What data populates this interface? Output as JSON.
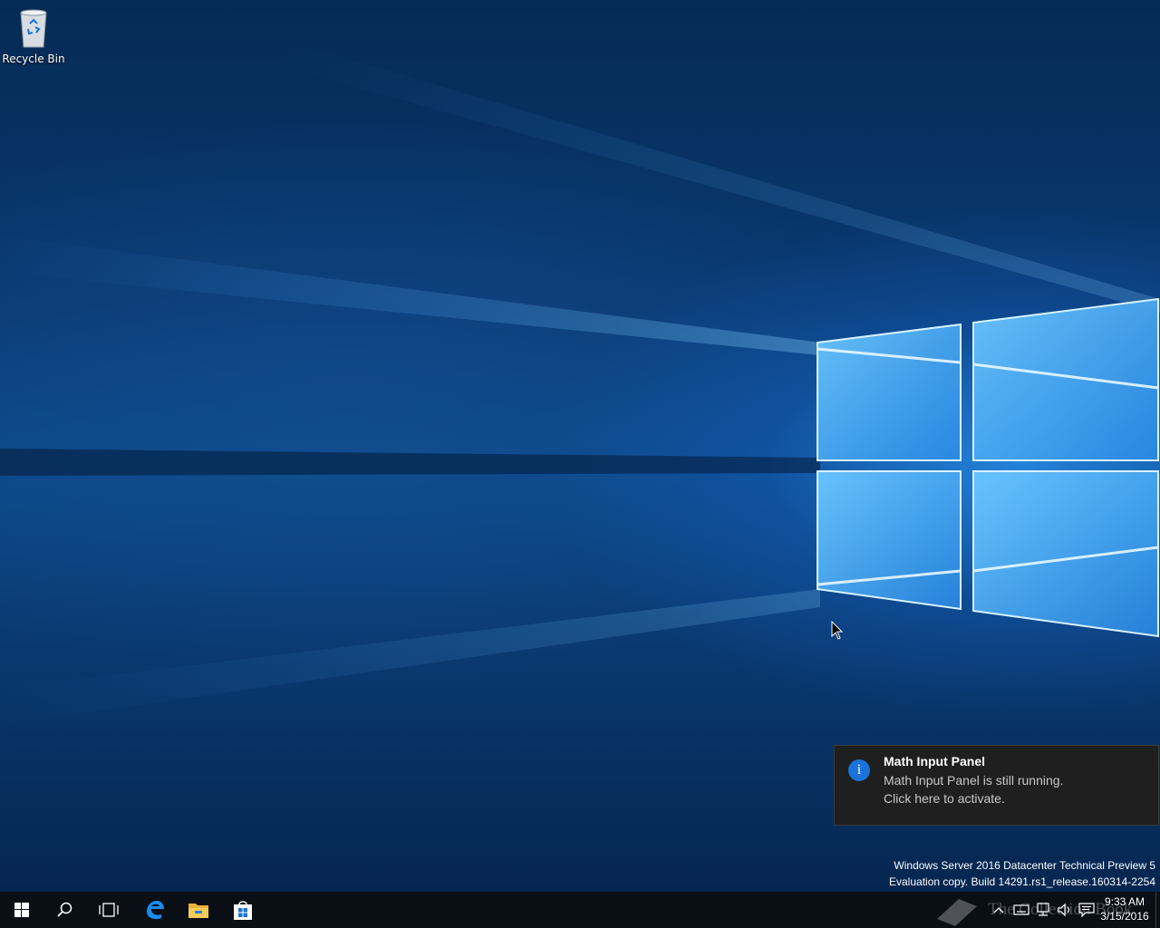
{
  "desktop": {
    "icons": [
      {
        "label": "Recycle Bin",
        "icon": "recycle-bin-icon"
      }
    ],
    "watermark": {
      "line1": "Windows Server 2016 Datacenter Technical Preview 5",
      "line2": "Evaluation copy. Build 14291.rs1_release.160314-2254"
    }
  },
  "toast": {
    "icon": "info-icon",
    "icon_glyph": "i",
    "title": "Math Input Panel",
    "line1": "Math Input Panel is still running.",
    "line2": "Click here to activate."
  },
  "taskbar": {
    "buttons": [
      {
        "name": "start",
        "icon": "windows-logo-icon"
      },
      {
        "name": "search",
        "icon": "search-icon"
      },
      {
        "name": "task-view",
        "icon": "task-view-icon"
      },
      {
        "name": "edge",
        "icon": "edge-browser-icon"
      },
      {
        "name": "file-explorer",
        "icon": "folder-icon"
      },
      {
        "name": "store",
        "icon": "store-bag-icon"
      }
    ],
    "tray": {
      "icons": [
        "chevron-up-icon",
        "keyboard-icon",
        "network-icon",
        "volume-icon",
        "action-center-icon"
      ],
      "time": "9:33 AM",
      "date": "3/15/2016"
    },
    "overlay_text": "The Collection Book"
  },
  "colors": {
    "accent": "#1a73d9",
    "taskbar": "#0a0f16",
    "toast_bg": "#1f1f1f"
  }
}
